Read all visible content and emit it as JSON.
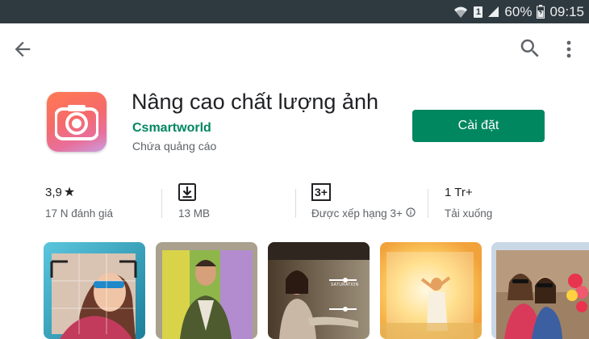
{
  "status_bar": {
    "battery": "60%",
    "time": "09:15",
    "sim_slot": "1"
  },
  "app": {
    "title": "Nâng cao chất lượng ảnh",
    "developer": "Csmartworld",
    "ads_notice": "Chứa quảng cáo",
    "install_label": "Cài đặt"
  },
  "stats": {
    "rating_value": "3,9",
    "rating_star": "★",
    "rating_count": "17 N đánh giá",
    "size": "13 MB",
    "content_rating_badge": "3+",
    "content_rating_label": "Được xếp hạng 3+",
    "downloads": "1 Tr+",
    "downloads_label": "Tải xuống"
  },
  "screenshots": {
    "shot_3_overlay": "SATURATION"
  },
  "colors": {
    "accent": "#01875f",
    "status_bar": "#2f3a40"
  }
}
